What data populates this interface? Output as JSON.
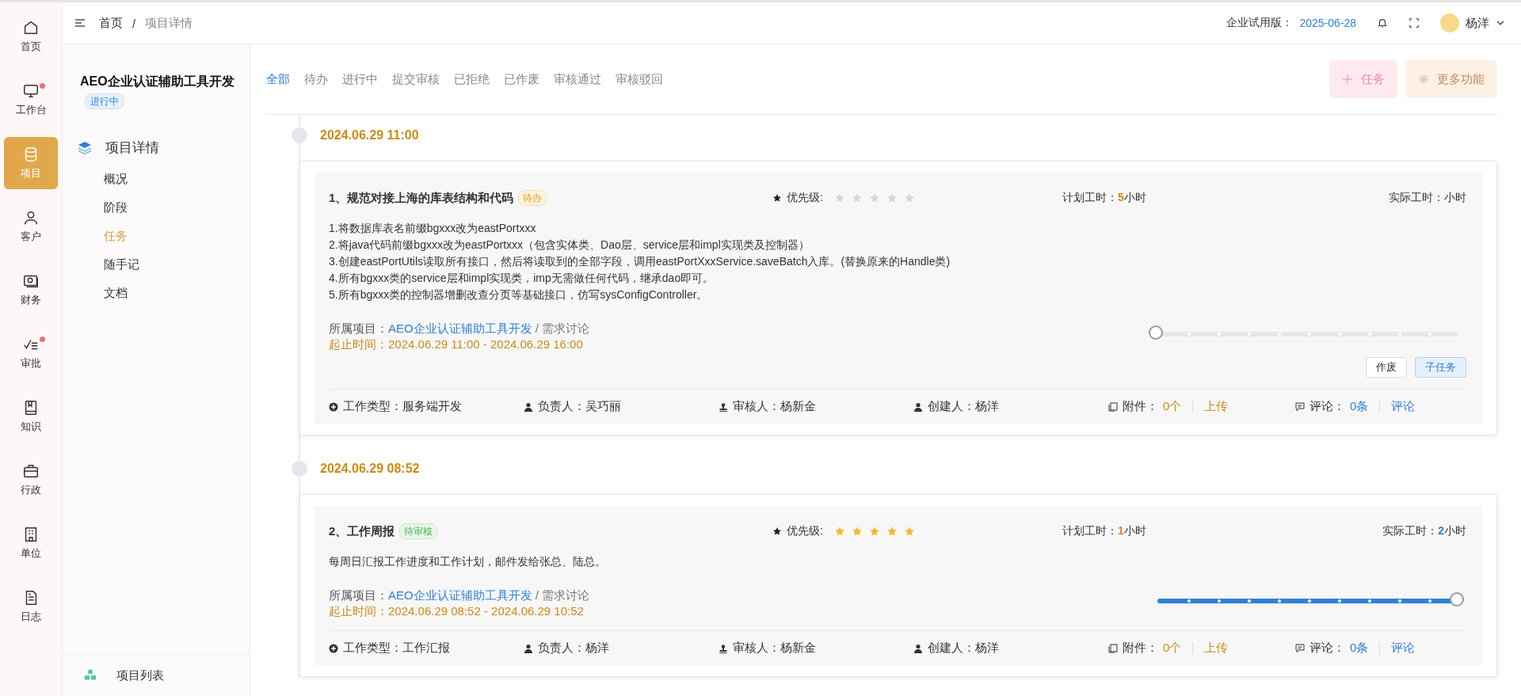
{
  "rail": [
    {
      "label": "首页",
      "kind": "home",
      "selected": false,
      "badge": false
    },
    {
      "label": "工作台",
      "kind": "monitor",
      "selected": false,
      "badge": true
    },
    {
      "label": "项目",
      "kind": "database",
      "selected": true,
      "badge": false
    },
    {
      "label": "客户",
      "kind": "user",
      "selected": false,
      "badge": false
    },
    {
      "label": "财务",
      "kind": "wallet",
      "selected": false,
      "badge": false
    },
    {
      "label": "审批",
      "kind": "checklist",
      "selected": false,
      "badge": true
    },
    {
      "label": "知识",
      "kind": "book",
      "selected": false,
      "badge": false
    },
    {
      "label": "行政",
      "kind": "briefcase",
      "selected": false,
      "badge": false
    },
    {
      "label": "单位",
      "kind": "building",
      "selected": false,
      "badge": false
    },
    {
      "label": "日志",
      "kind": "document",
      "selected": false,
      "badge": false
    }
  ],
  "breadcrumb": [
    "首页",
    "/",
    "项目详情"
  ],
  "header": {
    "trial_label": "企业试用版：",
    "trial_date": "2025-06-28",
    "user": "杨洋"
  },
  "sidebar": {
    "project": "AEO企业认证辅助工具开发",
    "status": "进行中",
    "section": "项目详情",
    "items": [
      {
        "label": "概况",
        "selected": false
      },
      {
        "label": "阶段",
        "selected": false
      },
      {
        "label": "任务",
        "selected": true
      },
      {
        "label": "随手记",
        "selected": false
      },
      {
        "label": "文档",
        "selected": false
      }
    ],
    "footer": "项目列表"
  },
  "filters": [
    {
      "label": "全部",
      "selected": true
    },
    {
      "label": "待办",
      "selected": false
    },
    {
      "label": "进行中",
      "selected": false
    },
    {
      "label": "提交审核",
      "selected": false
    },
    {
      "label": "已拒绝",
      "selected": false
    },
    {
      "label": "已作废",
      "selected": false
    },
    {
      "label": "审核通过",
      "selected": false
    },
    {
      "label": "审核驳回",
      "selected": false
    }
  ],
  "actions": [
    {
      "label": "任务",
      "kind": "add"
    },
    {
      "label": "更多功能",
      "kind": "more"
    }
  ],
  "tasks": [
    {
      "time": "2024.06.29 11:00",
      "title": "1、规范对接上海的库表结构和代码",
      "status": {
        "label": "待办",
        "kind": "todo"
      },
      "priority_label": "优先级:",
      "stars": 0,
      "planned": {
        "label": "计划工时：",
        "value": "5",
        "unit": "小时"
      },
      "actual": {
        "label": "实际工时：",
        "unit": "小时"
      },
      "description": [
        "1.将数据库表名前缀bgxxx改为eastPortxxx",
        "2.将java代码前缀bgxxx改为eastPortxxx（包含实体类、Dao层、service层和impl实现类及控制器）",
        "3.创建eastPortUtils读取所有接口，然后将读取到的全部字段，调用eastPortXxxService.saveBatch入库。(替换原来的Handle类)",
        "4.所有bgxxx类的service层和impl实现类，imp无需做任何代码，继承dao即可。",
        "5.所有bgxxx类的控制器增删改查分页等基础接口，仿写sysConfigController。"
      ],
      "project_label": "所属项目：",
      "project": "AEO企业认证辅助工具开发",
      "stage": "/ 需求讨论",
      "period_label": "起止时间：",
      "period": "2024.06.29 11:00 - 2024.06.29 16:00",
      "level": 0,
      "buttons": [
        {
          "label": "作废",
          "kind": "plain"
        },
        {
          "label": "子任务",
          "kind": "primary"
        }
      ],
      "fields": [
        {
          "label": "工作类型：服务端开发",
          "kind": "plus"
        },
        {
          "label": "负责人：吴巧丽",
          "kind": "person"
        },
        {
          "label": "审核人：杨新金",
          "kind": "stamp"
        },
        {
          "label": "创建人：杨洋",
          "kind": "person"
        }
      ],
      "attach": {
        "label": "附件：",
        "count": "0个",
        "action": "上传"
      },
      "comment": {
        "label": "评论：",
        "count": "0条",
        "action": "评论"
      }
    },
    {
      "time": "2024.06.29 08:52",
      "title": "2、工作周报",
      "status": {
        "label": "待审核",
        "kind": "review"
      },
      "priority_label": "优先级:",
      "stars": 5,
      "planned": {
        "label": "计划工时：",
        "value": "1",
        "unit": "小时"
      },
      "actual": {
        "label": "实际工时：",
        "value": "2",
        "unit": "小时"
      },
      "description": [
        "每周日汇报工作进度和工作计划，邮件发给张总、陆总。"
      ],
      "project_label": "所属项目：",
      "project": "AEO企业认证辅助工具开发",
      "stage": "/ 需求讨论",
      "period_label": "起止时间：",
      "period": "2024.06.29 08:52 - 2024.06.29 10:52",
      "level": 1,
      "fields": [
        {
          "label": "工作类型：工作汇报",
          "kind": "plus"
        },
        {
          "label": "负责人：杨洋",
          "kind": "person"
        },
        {
          "label": "审核人：杨新金",
          "kind": "stamp"
        },
        {
          "label": "创建人：杨洋",
          "kind": "person"
        }
      ],
      "attach": {
        "label": "附件：",
        "count": "0个",
        "action": "上传"
      },
      "comment": {
        "label": "评论：",
        "count": "0条",
        "action": "评论"
      }
    }
  ]
}
